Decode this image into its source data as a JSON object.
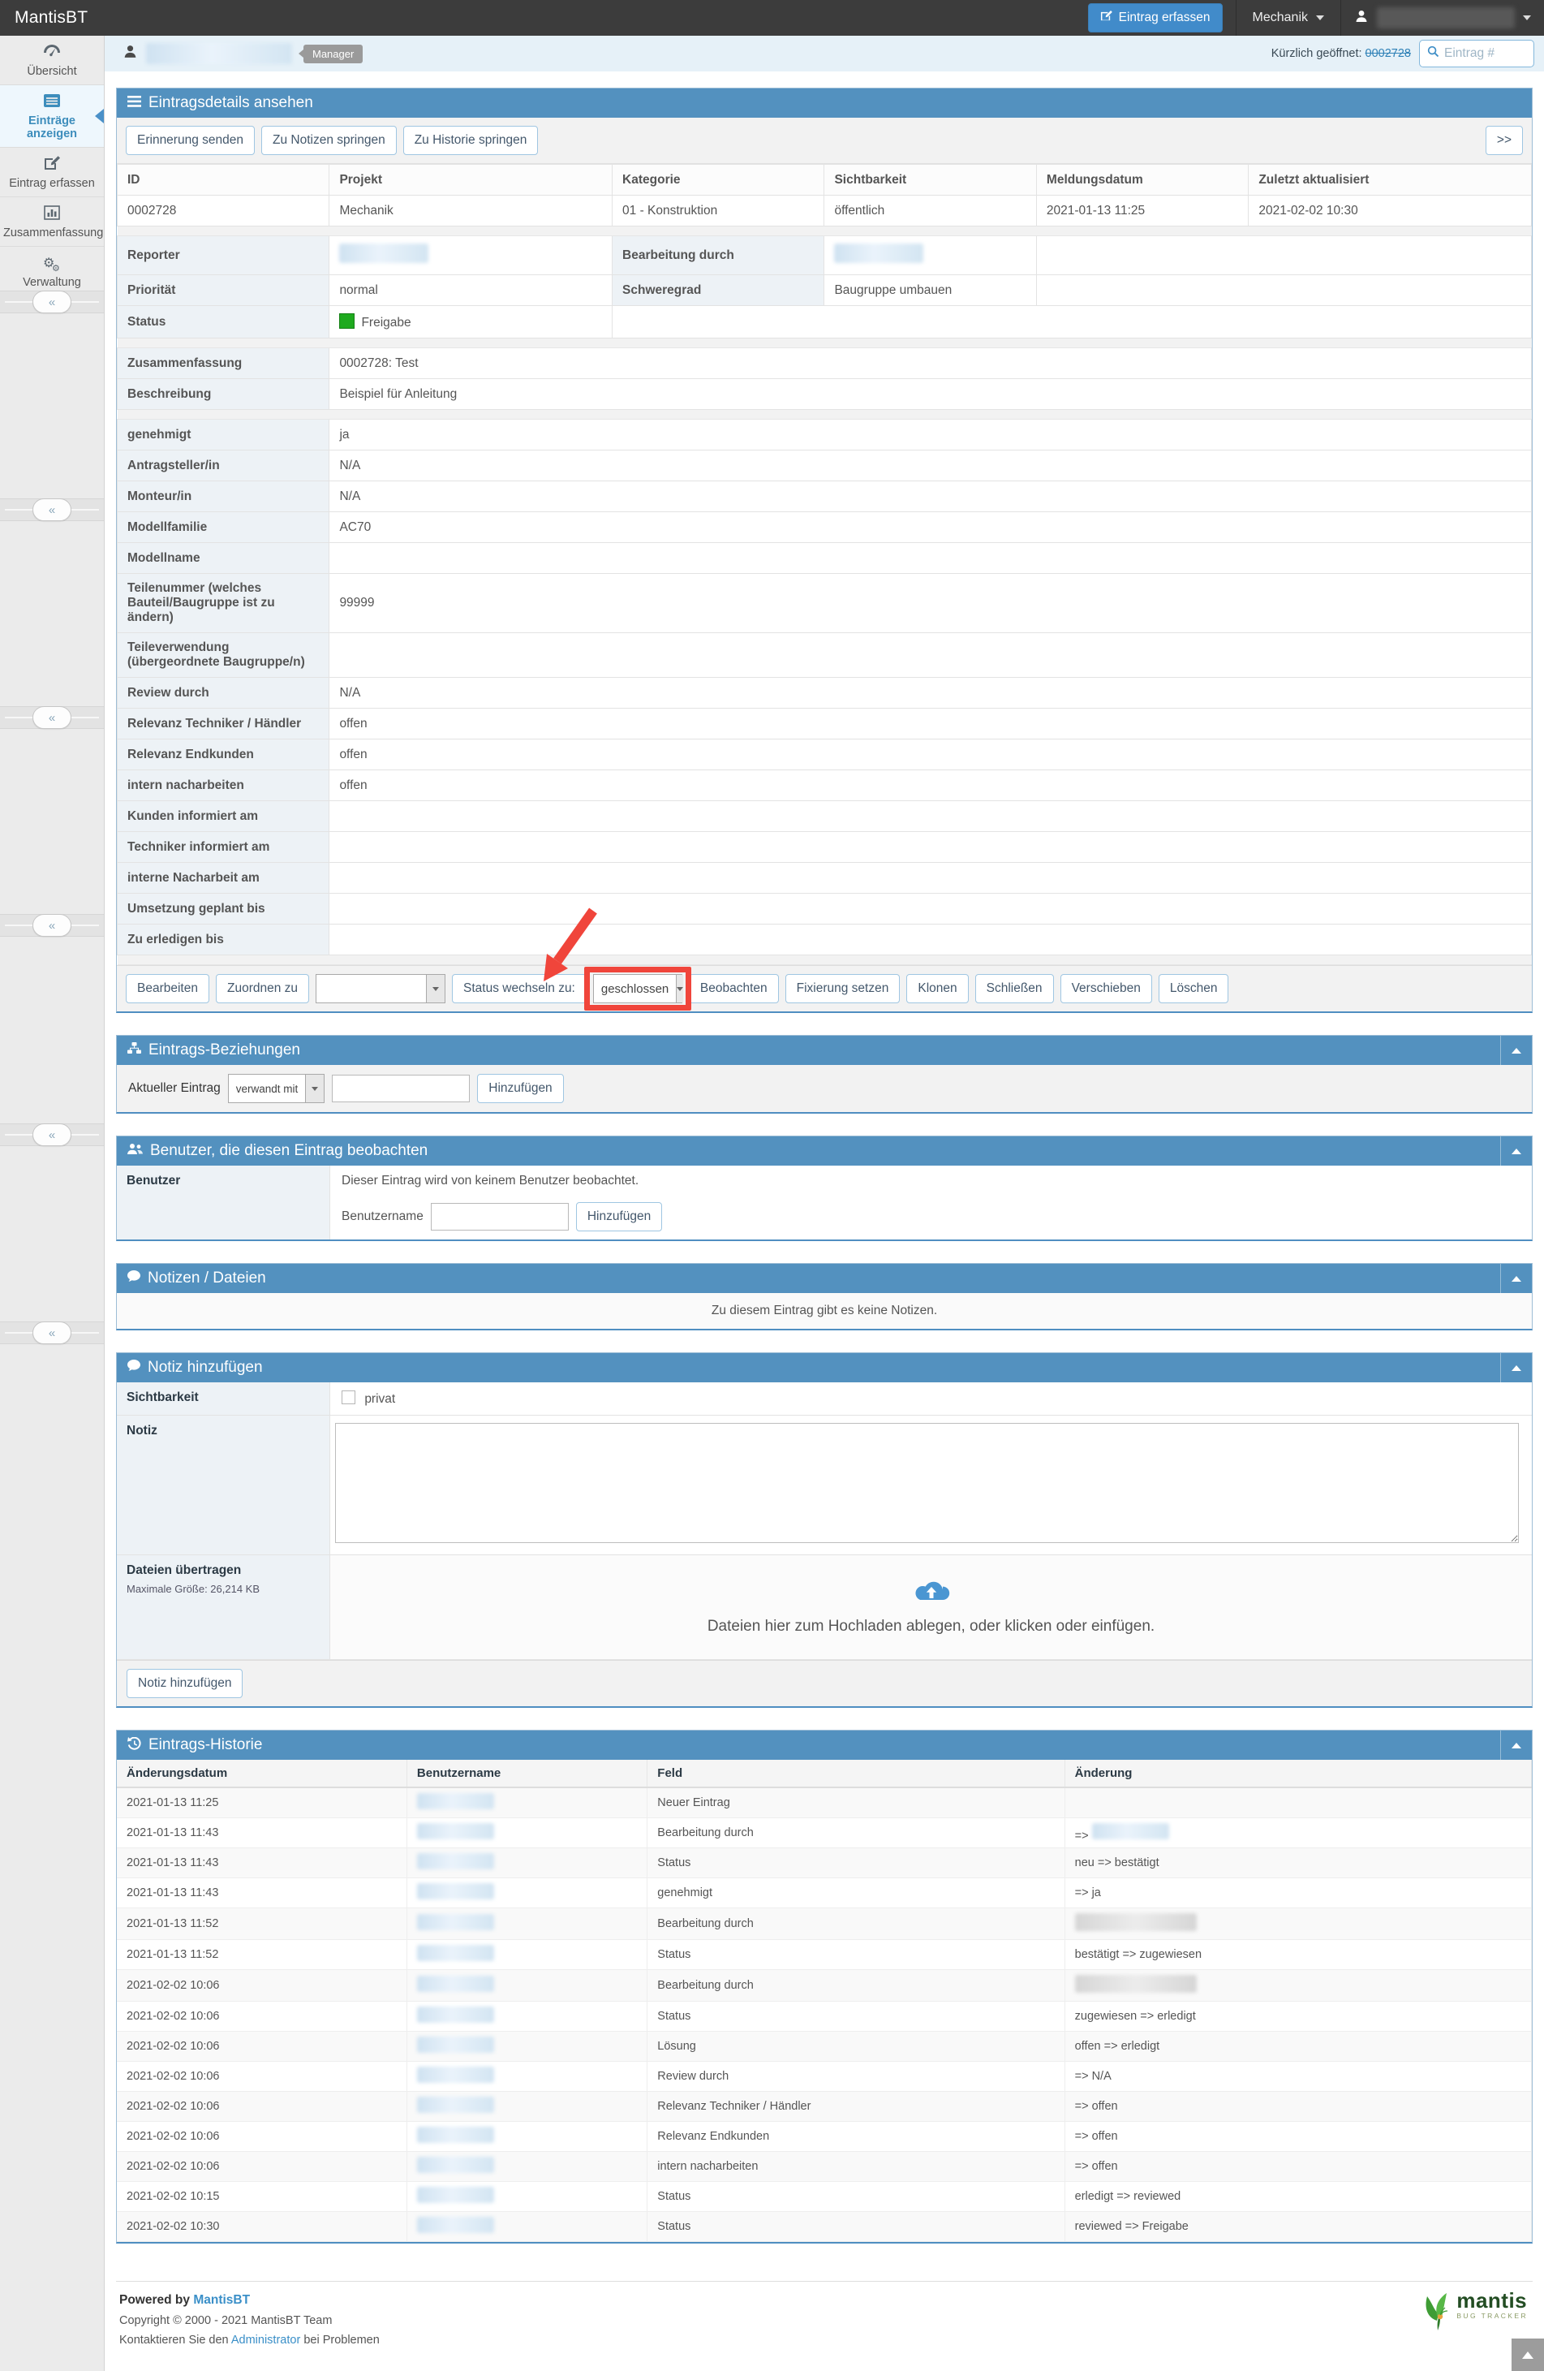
{
  "colors": {
    "accent": "#5391bf",
    "annotation": "#f0453b",
    "status_green": "#1faa1f",
    "navbar": "#3c3c3c"
  },
  "navbar": {
    "title": "MantisBT",
    "report_button": "Eintrag erfassen",
    "project": "Mechanik"
  },
  "userbar": {
    "role_badge": "Manager",
    "recent_label": "Kürzlich geöffnet:",
    "recent_id": "0002728",
    "search_placeholder": "Eintrag #"
  },
  "sidebar": {
    "items": [
      {
        "label": "Übersicht",
        "icon": "dashboard-icon",
        "active": false
      },
      {
        "label": "Einträge anzeigen",
        "icon": "list-icon",
        "active": true
      },
      {
        "label": "Eintrag erfassen",
        "icon": "edit-icon",
        "active": false
      },
      {
        "label": "Zusammenfassung",
        "icon": "chart-icon",
        "active": false
      },
      {
        "label": "Verwaltung",
        "icon": "gears-icon",
        "active": false
      }
    ],
    "collapse_glyph": "«"
  },
  "details": {
    "title": "Eintragsdetails ansehen",
    "toolbar": [
      "Erinnerung senden",
      "Zu Notizen springen",
      "Zu Historie springen"
    ],
    "expand_button": ">>",
    "table_rows": [
      {
        "cells": [
          {
            "k": "h",
            "t": "ID"
          },
          {
            "k": "h",
            "t": "Projekt"
          },
          {
            "k": "h",
            "t": "Kategorie"
          },
          {
            "k": "h",
            "t": "Sichtbarkeit"
          },
          {
            "k": "h",
            "t": "Meldungsdatum"
          },
          {
            "k": "h",
            "t": "Zuletzt aktualisiert"
          }
        ]
      },
      {
        "cells": [
          {
            "k": "v",
            "t": "0002728"
          },
          {
            "k": "v",
            "t": "Mechanik"
          },
          {
            "k": "v",
            "t": "01 - Konstruktion"
          },
          {
            "k": "v",
            "t": "öffentlich"
          },
          {
            "k": "v",
            "t": "2021-01-13 11:25"
          },
          {
            "k": "v",
            "t": "2021-02-02 10:30"
          }
        ]
      },
      {
        "spacer": true
      },
      {
        "cells": [
          {
            "k": "l",
            "t": "Reporter"
          },
          {
            "k": "b"
          },
          {
            "k": "l",
            "t": "Bearbeitung durch"
          },
          {
            "k": "b"
          },
          {
            "k": "e",
            "span": 2
          }
        ]
      },
      {
        "cells": [
          {
            "k": "l",
            "t": "Priorität"
          },
          {
            "k": "v",
            "t": "normal"
          },
          {
            "k": "l",
            "t": "Schweregrad"
          },
          {
            "k": "v",
            "t": "Baugruppe umbauen"
          },
          {
            "k": "e",
            "span": 2
          }
        ]
      },
      {
        "cells": [
          {
            "k": "l",
            "t": "Status"
          },
          {
            "k": "s",
            "t": "Freigabe"
          },
          {
            "k": "e",
            "span": 4
          }
        ]
      },
      {
        "spacer": true
      },
      {
        "cells": [
          {
            "k": "l",
            "t": "Zusammenfassung"
          },
          {
            "k": "v",
            "t": "0002728: Test",
            "span": 5
          }
        ]
      },
      {
        "cells": [
          {
            "k": "l",
            "t": "Beschreibung"
          },
          {
            "k": "v",
            "t": "Beispiel für Anleitung",
            "span": 5,
            "tall": true
          }
        ]
      },
      {
        "spacer": true
      },
      {
        "cells": [
          {
            "k": "l",
            "t": "genehmigt"
          },
          {
            "k": "v",
            "t": "ja",
            "span": 5
          }
        ]
      },
      {
        "cells": [
          {
            "k": "l",
            "t": "Antragsteller/in"
          },
          {
            "k": "v",
            "t": "N/A",
            "span": 5
          }
        ]
      },
      {
        "cells": [
          {
            "k": "l",
            "t": "Monteur/in"
          },
          {
            "k": "v",
            "t": "N/A",
            "span": 5
          }
        ]
      },
      {
        "cells": [
          {
            "k": "l",
            "t": "Modellfamilie"
          },
          {
            "k": "v",
            "t": "AC70",
            "span": 5
          }
        ]
      },
      {
        "cells": [
          {
            "k": "l",
            "t": "Modellname"
          },
          {
            "k": "v",
            "t": "",
            "span": 5
          }
        ]
      },
      {
        "cells": [
          {
            "k": "l",
            "t": "Teilenummer (welches Bauteil/Baugruppe ist zu ändern)"
          },
          {
            "k": "v",
            "t": "99999",
            "span": 5
          }
        ]
      },
      {
        "cells": [
          {
            "k": "l",
            "t": "Teileverwendung (übergeordnete Baugruppe/n)"
          },
          {
            "k": "v",
            "t": "",
            "span": 5
          }
        ]
      },
      {
        "cells": [
          {
            "k": "l",
            "t": "Review durch"
          },
          {
            "k": "v",
            "t": "N/A",
            "span": 5
          }
        ]
      },
      {
        "cells": [
          {
            "k": "l",
            "t": "Relevanz Techniker / Händler"
          },
          {
            "k": "v",
            "t": "offen",
            "span": 5
          }
        ]
      },
      {
        "cells": [
          {
            "k": "l",
            "t": "Relevanz Endkunden"
          },
          {
            "k": "v",
            "t": "offen",
            "span": 5
          }
        ]
      },
      {
        "cells": [
          {
            "k": "l",
            "t": "intern nacharbeiten"
          },
          {
            "k": "v",
            "t": "offen",
            "span": 5
          }
        ]
      },
      {
        "cells": [
          {
            "k": "l",
            "t": "Kunden informiert am"
          },
          {
            "k": "v",
            "t": "",
            "span": 5
          }
        ]
      },
      {
        "cells": [
          {
            "k": "l",
            "t": "Techniker informiert am"
          },
          {
            "k": "v",
            "t": "",
            "span": 5
          }
        ]
      },
      {
        "cells": [
          {
            "k": "l",
            "t": "interne Nacharbeit am"
          },
          {
            "k": "v",
            "t": "",
            "span": 5
          }
        ]
      },
      {
        "cells": [
          {
            "k": "l",
            "t": "Umsetzung geplant bis"
          },
          {
            "k": "v",
            "t": "",
            "span": 5
          }
        ]
      },
      {
        "cells": [
          {
            "k": "l",
            "t": "Zu erledigen bis"
          },
          {
            "k": "v",
            "t": "",
            "span": 5
          }
        ]
      },
      {
        "spacer": true
      }
    ],
    "actions": {
      "edit": "Bearbeiten",
      "assign": "Zuordnen zu",
      "status_label": "Status wechseln zu:",
      "status_value": "geschlossen",
      "after": [
        "Beobachten",
        "Fixierung setzen",
        "Klonen",
        "Schließen",
        "Verschieben",
        "Löschen"
      ]
    }
  },
  "relationships": {
    "title": "Eintrags-Beziehungen",
    "current_label": "Aktueller Eintrag",
    "relation_select": "verwandt mit",
    "add_button": "Hinzufügen"
  },
  "watchers": {
    "title": "Benutzer, die diesen Eintrag beobachten",
    "row_label": "Benutzer",
    "empty_text": "Dieser Eintrag wird von keinem Benutzer beobachtet.",
    "username_label": "Benutzername",
    "add_button": "Hinzufügen"
  },
  "notes": {
    "title": "Notizen / Dateien",
    "empty_text": "Zu diesem Eintrag gibt es keine Notizen."
  },
  "add_note": {
    "title": "Notiz hinzufügen",
    "visibility_label": "Sichtbarkeit",
    "private_label": "privat",
    "note_label": "Notiz",
    "files_label": "Dateien übertragen",
    "max_size": "Maximale Größe: 26,214 KB",
    "dropzone_text": "Dateien hier zum Hochladen ablegen, oder klicken oder einfügen.",
    "submit_button": "Notiz hinzufügen"
  },
  "history": {
    "title": "Eintrags-Historie",
    "headers": [
      "Änderungsdatum",
      "Benutzername",
      "Feld",
      "Änderung"
    ],
    "rows": [
      {
        "date": "2021-01-13 11:25",
        "field": "Neuer Eintrag",
        "change": "",
        "blur": "none"
      },
      {
        "date": "2021-01-13 11:43",
        "field": "Bearbeitung durch",
        "change": "=>",
        "blur": "after"
      },
      {
        "date": "2021-01-13 11:43",
        "field": "Status",
        "change": "neu => bestätigt",
        "blur": "none"
      },
      {
        "date": "2021-01-13 11:43",
        "field": "genehmigt",
        "change": "=> ja",
        "blur": "none"
      },
      {
        "date": "2021-01-13 11:52",
        "field": "Bearbeitung durch",
        "change": "",
        "blur": "full"
      },
      {
        "date": "2021-01-13 11:52",
        "field": "Status",
        "change": "bestätigt => zugewiesen",
        "blur": "none"
      },
      {
        "date": "2021-02-02 10:06",
        "field": "Bearbeitung durch",
        "change": "",
        "blur": "full"
      },
      {
        "date": "2021-02-02 10:06",
        "field": "Status",
        "change": "zugewiesen => erledigt",
        "blur": "none"
      },
      {
        "date": "2021-02-02 10:06",
        "field": "Lösung",
        "change": "offen => erledigt",
        "blur": "none"
      },
      {
        "date": "2021-02-02 10:06",
        "field": "Review durch",
        "change": "=> N/A",
        "blur": "none"
      },
      {
        "date": "2021-02-02 10:06",
        "field": "Relevanz Techniker / Händler",
        "change": "=> offen",
        "blur": "none"
      },
      {
        "date": "2021-02-02 10:06",
        "field": "Relevanz Endkunden",
        "change": "=> offen",
        "blur": "none"
      },
      {
        "date": "2021-02-02 10:06",
        "field": "intern nacharbeiten",
        "change": "=> offen",
        "blur": "none"
      },
      {
        "date": "2021-02-02 10:15",
        "field": "Status",
        "change": "erledigt => reviewed",
        "blur": "none"
      },
      {
        "date": "2021-02-02 10:30",
        "field": "Status",
        "change": "reviewed => Freigabe",
        "blur": "none"
      }
    ]
  },
  "footer": {
    "powered_prefix": "Powered by",
    "powered_link": "MantisBT",
    "copyright": "Copyright © 2000 - 2021 MantisBT Team",
    "contact_prefix": "Kontaktieren Sie den",
    "contact_link": "Administrator",
    "contact_suffix": "bei Problemen",
    "logo_text": "mantis",
    "logo_sub": "BUG TRACKER"
  }
}
